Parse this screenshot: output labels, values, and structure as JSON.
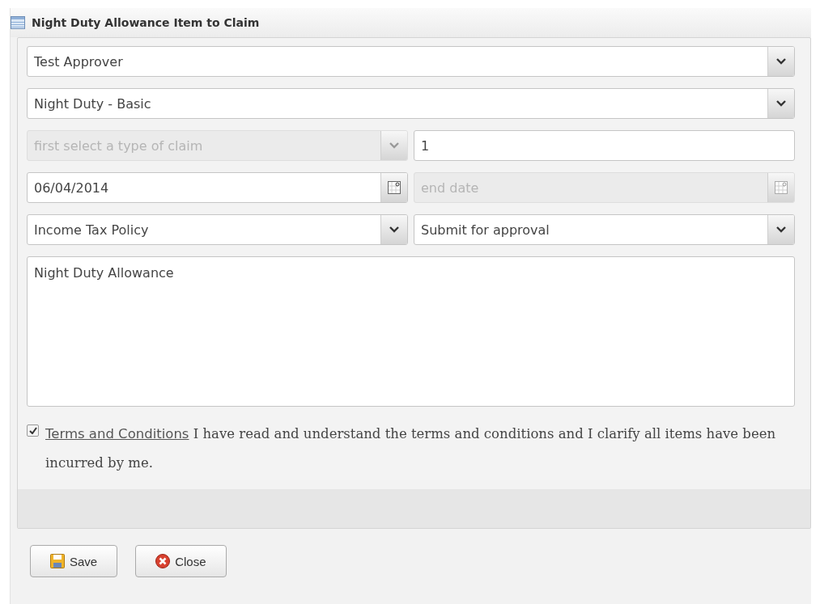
{
  "window": {
    "title": "Night Duty Allowance Item to Claim"
  },
  "rows": [
    [
      {
        "kind": "combo",
        "value": "Test Approver",
        "disabled": false
      }
    ],
    [
      {
        "kind": "combo",
        "value": "Night Duty - Basic",
        "disabled": false
      }
    ],
    [
      {
        "kind": "combo",
        "placeholder": "first select a type of claim",
        "disabled": true
      },
      {
        "kind": "text",
        "value": "1",
        "disabled": false
      }
    ],
    [
      {
        "kind": "date",
        "value": "06/04/2014",
        "disabled": false
      },
      {
        "kind": "date",
        "placeholder": "end date",
        "disabled": true
      }
    ],
    [
      {
        "kind": "combo",
        "value": "Income Tax Policy",
        "disabled": false
      },
      {
        "kind": "combo",
        "value": "Submit for approval",
        "disabled": false
      }
    ],
    [
      {
        "kind": "textarea",
        "value": "Night Duty Allowance",
        "disabled": false
      }
    ]
  ],
  "terms": {
    "checked": true,
    "link": "Terms and Conditions",
    "text": "I have read and understand the terms and conditions and I clarify all items have been incurred by me."
  },
  "buttons": [
    {
      "kind": "save",
      "label": "Save"
    },
    {
      "kind": "close",
      "label": "Close"
    }
  ]
}
